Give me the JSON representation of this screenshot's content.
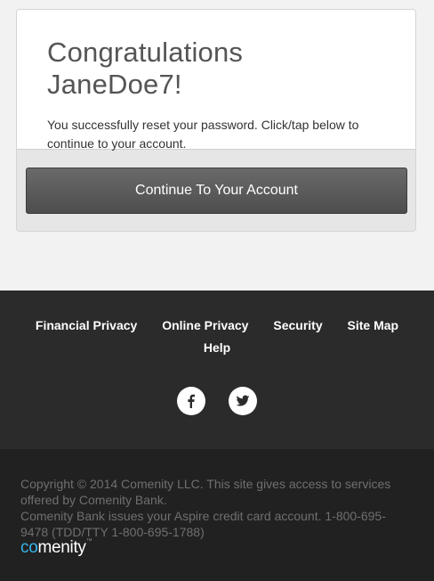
{
  "card": {
    "title": "Congratulations JaneDoe7!",
    "message": "You successfully reset your password. Click/tap below to continue to your account.",
    "button_label": "Continue To Your Account"
  },
  "footer": {
    "links": [
      "Financial Privacy",
      "Online Privacy",
      "Security",
      "Site Map",
      "Help"
    ],
    "social": [
      "facebook-icon",
      "twitter-icon"
    ],
    "copyright": "Copyright © 2014 Comenity LLC. This site gives access to services offered by Comenity Bank.",
    "issuer_note": "Comenity Bank issues your Aspire credit card account. 1-800-695-9478 (TDD/TTY 1-800-695-1788)",
    "logo": {
      "part1": "co",
      "part2": "menity",
      "mark": "™"
    }
  },
  "colors": {
    "logo_accent": "#35b5e8",
    "button": "#5a5a5a",
    "footer_top": "#2b2b2b",
    "footer_bottom": "#212121"
  }
}
